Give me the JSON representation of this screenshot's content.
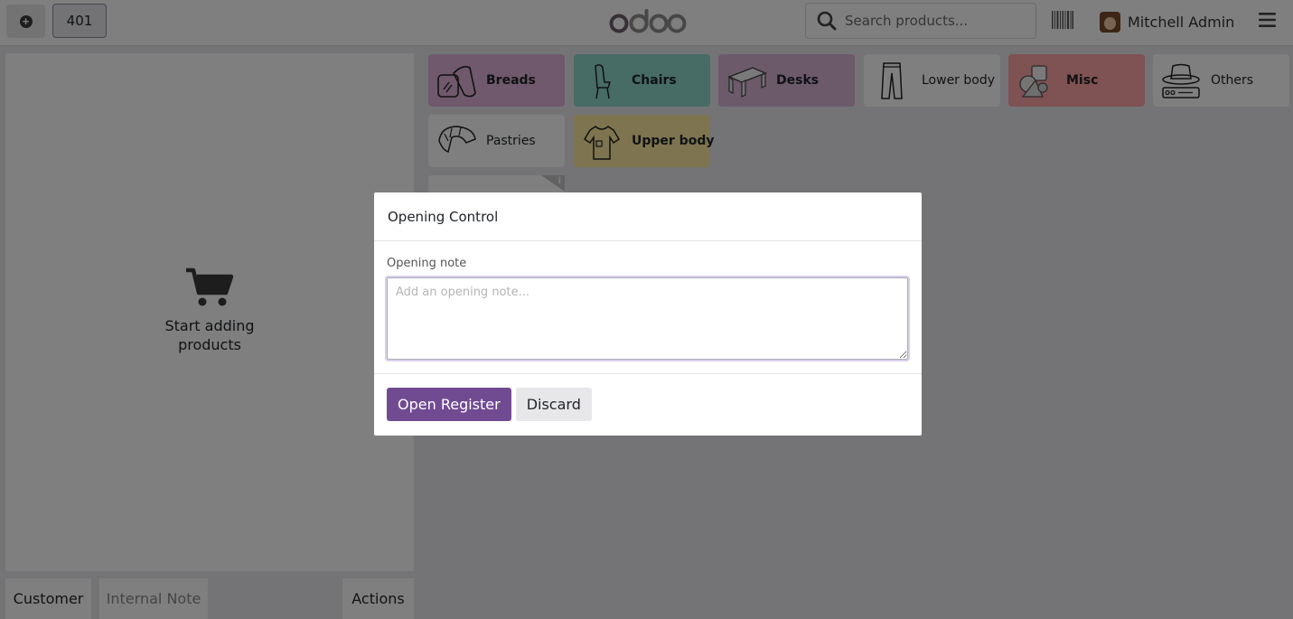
{
  "topbar": {
    "order_number": "401",
    "logo_text": "odoo",
    "search_placeholder": "Search products...",
    "user_name": "Mitchell Admin"
  },
  "order_panel": {
    "empty_title": "Start adding products",
    "buttons": {
      "customer": "Customer",
      "internal_note": "Internal Note",
      "actions": "Actions"
    }
  },
  "categories": [
    {
      "label": "Breads",
      "color": "#e1b3d8",
      "icon": "bread-icon"
    },
    {
      "label": "Chairs",
      "color": "#8fd6cb",
      "icon": "chair-icon"
    },
    {
      "label": "Desks",
      "color": "#d9b4d7",
      "icon": "desk-icon"
    },
    {
      "label": "Lower body",
      "color": "#ffffff",
      "icon": "pants-icon"
    },
    {
      "label": "Misc",
      "color": "#ffa4a7",
      "icon": "misc-icon"
    },
    {
      "label": "Others",
      "color": "#ffffff",
      "icon": "hat-icon"
    },
    {
      "label": "Pastries",
      "color": "#ffffff",
      "icon": "croissant-icon"
    },
    {
      "label": "Upper body",
      "color": "#fde99e",
      "icon": "shirt-icon"
    }
  ],
  "modal": {
    "title": "Opening Control",
    "note_label": "Opening note",
    "note_placeholder": "Add an opening note...",
    "note_value": "",
    "primary_button": "Open Register",
    "secondary_button": "Discard"
  },
  "colors": {
    "brand": "#714b92",
    "overlay": "rgba(0,0,0,0.5)"
  }
}
